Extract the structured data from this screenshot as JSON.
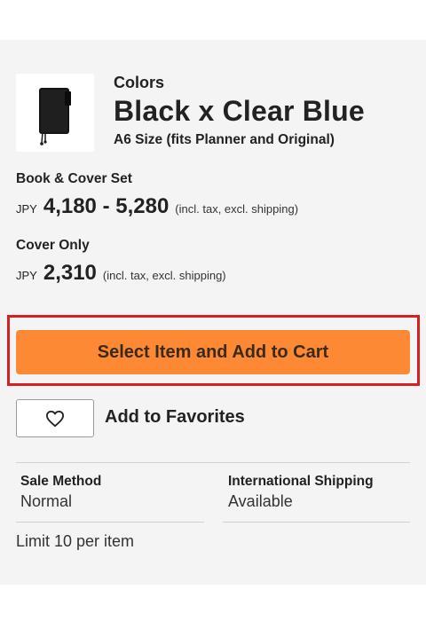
{
  "product": {
    "label": "Colors",
    "title": "Black x Clear Blue",
    "subtitle": "A6 Size (fits Planner and Original)",
    "thumbnail_alt": "black-planner-cover"
  },
  "prices": [
    {
      "title": "Book & Cover Set",
      "currency": "JPY",
      "amount": "4,180 - 5,280",
      "note": "(incl. tax, excl. shipping)"
    },
    {
      "title": "Cover Only",
      "currency": "JPY",
      "amount": "2,310",
      "note": "(incl. tax, excl. shipping)"
    }
  ],
  "cart_button": {
    "label": "Select Item and Add to Cart",
    "color": "#fd8935",
    "highlight_color": "#d6201f"
  },
  "favorites": {
    "label": "Add to Favorites",
    "icon": "heart-outline-icon"
  },
  "info": {
    "sale_method": {
      "label": "Sale Method",
      "value": "Normal"
    },
    "international_shipping": {
      "label": "International Shipping",
      "value": "Available"
    }
  },
  "limit": "Limit 10 per item"
}
